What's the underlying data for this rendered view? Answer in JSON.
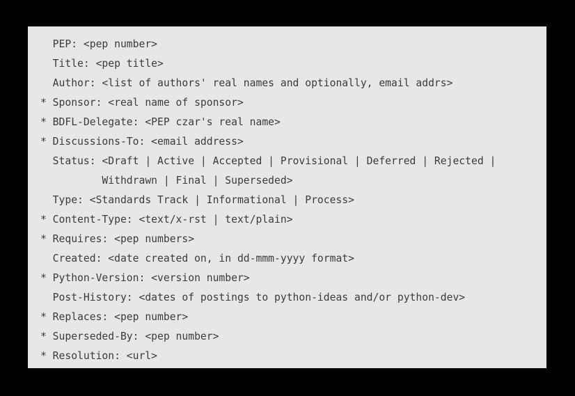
{
  "panel": {
    "background_color": "#e6e7e8",
    "text_color": "#3a3b3d",
    "page_background_color": "#000000"
  },
  "code_block": {
    "language": "text",
    "line_count": 18,
    "lines": [
      "  PEP: <pep number>",
      "  Title: <pep title>",
      "  Author: <list of authors' real names and optionally, email addrs>",
      "* Sponsor: <real name of sponsor>",
      "* BDFL-Delegate: <PEP czar's real name>",
      "* Discussions-To: <email address>",
      "  Status: <Draft | Active | Accepted | Provisional | Deferred | Rejected |",
      "          Withdrawn | Final | Superseded>",
      "  Type: <Standards Track | Informational | Process>",
      "* Content-Type: <text/x-rst | text/plain>",
      "* Requires: <pep numbers>",
      "  Created: <date created on, in dd-mmm-yyyy format>",
      "* Python-Version: <version number>",
      "  Post-History: <dates of postings to python-ideas and/or python-dev>",
      "* Replaces: <pep number>",
      "* Superseded-By: <pep number>",
      "* Resolution: <url>"
    ]
  }
}
